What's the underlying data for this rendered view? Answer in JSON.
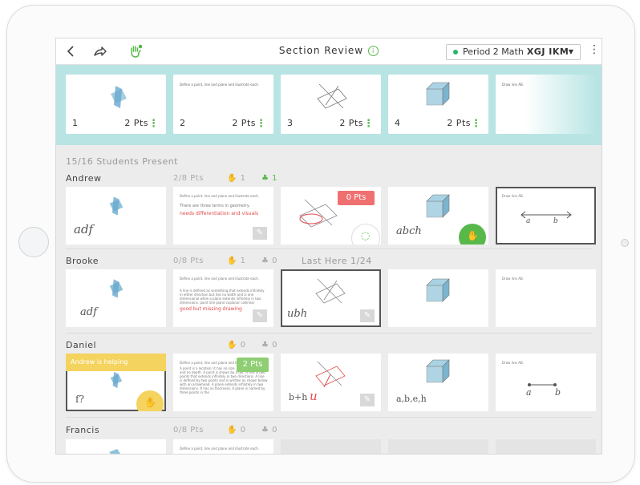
{
  "topbar": {
    "title": "Section Review",
    "info_glyph": "i",
    "period_label": "Period 2 Math",
    "period_code": "XGJ IKM",
    "icons": [
      "back-icon",
      "share-icon",
      "raised-hand-icon",
      "more-icon"
    ]
  },
  "questions": [
    {
      "num": "1",
      "pts": "2 Pts",
      "caption": ""
    },
    {
      "num": "2",
      "pts": "2 Pts",
      "caption": "Define a point, line and plane and illustrate each."
    },
    {
      "num": "3",
      "pts": "2 Pts",
      "caption": ""
    },
    {
      "num": "4",
      "pts": "2 Pts",
      "caption": ""
    },
    {
      "num": "",
      "pts": "",
      "caption": "Draw line AB."
    }
  ],
  "present": "15/16 Students Present",
  "students": [
    {
      "name": "Andrew",
      "pts": "2/8 Pts",
      "hands": "1",
      "helping": "1",
      "last_here": "",
      "cards": [
        {
          "hand": "adf"
        },
        {
          "prompt": "Define a point, line and plane and illustrate each.",
          "answer": "There are three terms in geometry.",
          "feedback": "needs differentiation and visuals"
        },
        {
          "badge": "0 Pts"
        },
        {
          "hand": "abch"
        },
        {
          "prompt": "Draw line AB.",
          "labels": [
            "a",
            "b"
          ]
        }
      ]
    },
    {
      "name": "Brooke",
      "pts": "0/8 Pts",
      "hands": "1",
      "helping": "0",
      "last_here": "Last Here 1/24",
      "cards": [
        {
          "hand": "adf"
        },
        {
          "prompt": "Define a point, line and plane and illustrate each.",
          "answer": "A line is defined as something that extends infinitely in either direction but has no width and is one dimensional while a plane extends infinitely in two dimensions. point line plane coplanar collinear",
          "feedback": "good but missing drawing"
        },
        {
          "hand": "ubh"
        },
        {},
        {
          "prompt": "Draw line AB."
        }
      ]
    },
    {
      "name": "Daniel",
      "pts": "",
      "hands": "0",
      "helping": "0",
      "last_here": "",
      "cards": [
        {
          "banner": "Andrew is helping",
          "hand": "f?"
        },
        {
          "prompt": "Define a point, line and plane and illustrate each.",
          "answer": "A point is a location; it has no size. A line has length and no depth. A point is shown by a dot. A line is two points that extends infinitely in two directions. A line is defined by two points and is written as shown below with an arrowhead. A plane extends infinitely in two dimensions. It has no thickness. A plane is named by three points in the",
          "badge": "2 Pts"
        },
        {
          "hand": "b+h"
        },
        {
          "hand": "a,b,e,h"
        },
        {
          "prompt": "Draw line AB.",
          "labels": [
            "a",
            "b"
          ]
        }
      ]
    },
    {
      "name": "Francis",
      "pts": "0/8 Pts",
      "hands": "0",
      "helping": "0",
      "last_here": "",
      "cards": [
        {},
        {
          "prompt": "Define a point, line and plane and illustrate each."
        },
        {},
        {},
        {}
      ]
    }
  ],
  "colors": {
    "accent_green": "#58b84a",
    "strip": "#b8e4e4",
    "red": "#f07070",
    "yellow": "#f4d35e",
    "cube_blue": "#8ec3d9"
  }
}
